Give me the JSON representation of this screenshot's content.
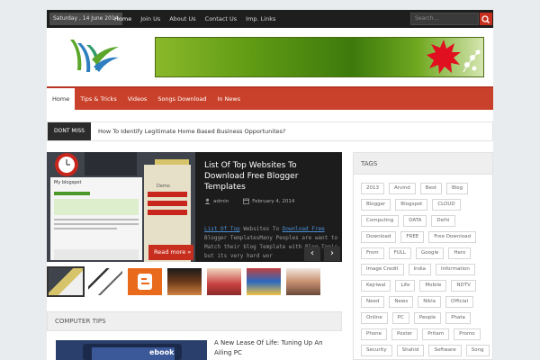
{
  "topbar": {
    "date": "Saturday , 14 June 2014",
    "nav": [
      "Home",
      "Join Us",
      "About Us",
      "Contact Us",
      "Imp. Links"
    ],
    "search_placeholder": "Search..."
  },
  "mainnav": [
    "Home",
    "Tips & Tricks",
    "Videos",
    "Songs Download",
    "In News"
  ],
  "dontmiss": {
    "label": "DONT MISS",
    "headline": "How To Identify Legitimate Home Based Business Opportunites?"
  },
  "slider": {
    "title": "List Of Top Websites To Download Free Blogger Templates",
    "author": "admin",
    "date": "February 4, 2014",
    "excerpt_link1": "List Of Top",
    "excerpt_mid": " Websites To ",
    "excerpt_link2": "Download Free",
    "excerpt_rest": " Blogger TemplatesMany Peoples are want to Match their blog Template with Blog Topic but its very hard wor",
    "read_more": "Read more »",
    "prev": "‹",
    "next": "›",
    "screenshot_heading": "My blogspot",
    "screenshot_menu_title": "Demo"
  },
  "tips": {
    "heading": "COMPUTER TIPS",
    "first_title": "A New Lease Of Life: Tuning Up An Ailing PC",
    "image_text": "ebook"
  },
  "tags": {
    "heading": "TAGS",
    "items": [
      "2013",
      "Arvind",
      "Best",
      "Blog",
      "Blogger",
      "Blogspot",
      "CLOUD",
      "Computing",
      "DATA",
      "Delhi",
      "Download",
      "FREE",
      "Free Download",
      "From",
      "FULL",
      "Google",
      "Hero",
      "Image Credit",
      "India",
      "Information",
      "Kejriwal",
      "Life",
      "Mobile",
      "NDTV",
      "Need",
      "News",
      "Nikla",
      "Official",
      "Online",
      "PC",
      "People",
      "Phata",
      "Phone",
      "Poster",
      "Pritam",
      "Promo",
      "Security",
      "Shahid",
      "Software",
      "Song"
    ]
  },
  "colors": {
    "accent": "#c9412a",
    "dark": "#1e1e1e",
    "link": "#4a8fd6"
  }
}
